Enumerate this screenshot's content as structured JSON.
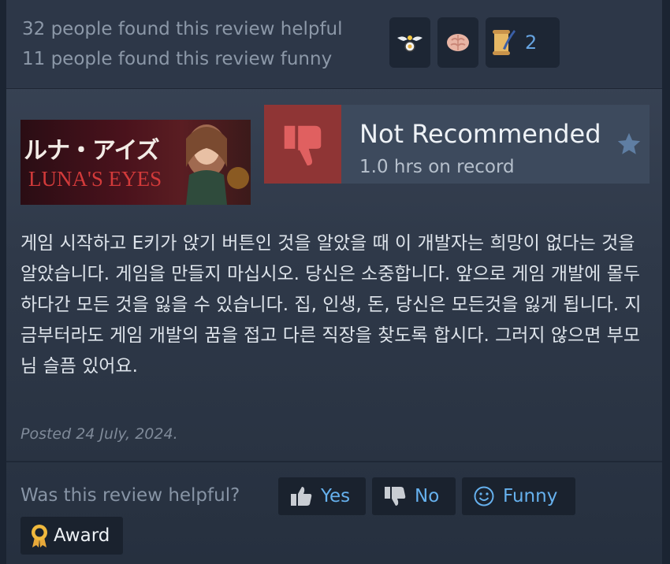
{
  "stats": {
    "helpful": "32 people found this review helpful",
    "funny": "11 people found this review funny"
  },
  "awards": {
    "icons": [
      "winged-badge-icon",
      "brain-icon",
      "scroll-quill-icon"
    ],
    "count": "2"
  },
  "game": {
    "title_jp": "ルナ・アイズ",
    "title_en": "LUNA'S EYES"
  },
  "review": {
    "verdict": "Not Recommended",
    "hours": "1.0 hrs on record",
    "text": "게임 시작하고 E키가 앉기 버튼인 것을 알았을 때 이 개발자는 희망이 없다는 것을 알았습니다. 게임을 만들지 마십시오. 당신은 소중합니다. 앞으로 게임 개발에 몰두 하다간 모든 것을 잃을 수 있습니다. 집, 인생, 돈, 당신은 모든것을 잃게 됩니다. 지금부터라도 게임 개발의 꿈을 접고 다른 직장을 찾도록 합시다. 그러지 않으면 부모님 슬픔 있어요.",
    "posted": "Posted 24 July, 2024."
  },
  "feedback": {
    "question": "Was this review helpful?",
    "yes": "Yes",
    "no": "No",
    "funny": "Funny",
    "award": "Award"
  },
  "colors": {
    "background": "#2f3949",
    "thumbs_down": "#8f3535",
    "accent_blue": "#66b1ee",
    "award_count": "#66a3e0"
  }
}
